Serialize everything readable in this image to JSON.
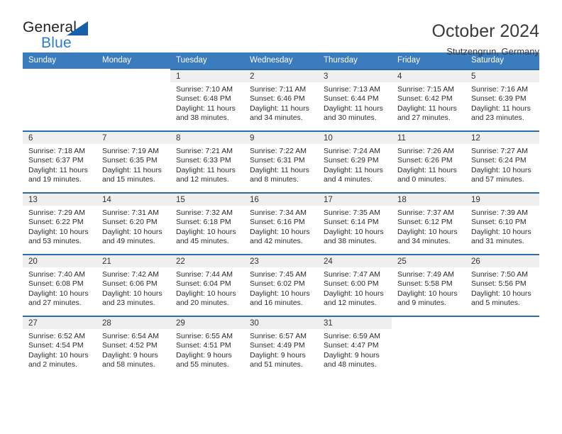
{
  "brand": {
    "name_part1": "General",
    "name_part2": "Blue",
    "triangle_color": "#1560a8",
    "blue_color": "#2b7cd3"
  },
  "header": {
    "title": "October 2024",
    "subtitle": "Stutzengrun, Germany"
  },
  "theme": {
    "header_bar_color": "#3a7cbe",
    "cell_rule_color": "#2d6da4",
    "daynum_band_color": "#efefef"
  },
  "weekday_headers": [
    "Sunday",
    "Monday",
    "Tuesday",
    "Wednesday",
    "Thursday",
    "Friday",
    "Saturday"
  ],
  "weeks": [
    [
      {
        "blank": true,
        "lead": true,
        "day": "",
        "sunrise": "",
        "sunset": "",
        "daylight": ""
      },
      {
        "blank": true,
        "lead": true,
        "day": "",
        "sunrise": "",
        "sunset": "",
        "daylight": ""
      },
      {
        "day": "1",
        "sunrise": "Sunrise: 7:10 AM",
        "sunset": "Sunset: 6:48 PM",
        "daylight": "Daylight: 11 hours and 38 minutes."
      },
      {
        "day": "2",
        "sunrise": "Sunrise: 7:11 AM",
        "sunset": "Sunset: 6:46 PM",
        "daylight": "Daylight: 11 hours and 34 minutes."
      },
      {
        "day": "3",
        "sunrise": "Sunrise: 7:13 AM",
        "sunset": "Sunset: 6:44 PM",
        "daylight": "Daylight: 11 hours and 30 minutes."
      },
      {
        "day": "4",
        "sunrise": "Sunrise: 7:15 AM",
        "sunset": "Sunset: 6:42 PM",
        "daylight": "Daylight: 11 hours and 27 minutes."
      },
      {
        "day": "5",
        "sunrise": "Sunrise: 7:16 AM",
        "sunset": "Sunset: 6:39 PM",
        "daylight": "Daylight: 11 hours and 23 minutes."
      }
    ],
    [
      {
        "day": "6",
        "sunrise": "Sunrise: 7:18 AM",
        "sunset": "Sunset: 6:37 PM",
        "daylight": "Daylight: 11 hours and 19 minutes."
      },
      {
        "day": "7",
        "sunrise": "Sunrise: 7:19 AM",
        "sunset": "Sunset: 6:35 PM",
        "daylight": "Daylight: 11 hours and 15 minutes."
      },
      {
        "day": "8",
        "sunrise": "Sunrise: 7:21 AM",
        "sunset": "Sunset: 6:33 PM",
        "daylight": "Daylight: 11 hours and 12 minutes."
      },
      {
        "day": "9",
        "sunrise": "Sunrise: 7:22 AM",
        "sunset": "Sunset: 6:31 PM",
        "daylight": "Daylight: 11 hours and 8 minutes."
      },
      {
        "day": "10",
        "sunrise": "Sunrise: 7:24 AM",
        "sunset": "Sunset: 6:29 PM",
        "daylight": "Daylight: 11 hours and 4 minutes."
      },
      {
        "day": "11",
        "sunrise": "Sunrise: 7:26 AM",
        "sunset": "Sunset: 6:26 PM",
        "daylight": "Daylight: 11 hours and 0 minutes."
      },
      {
        "day": "12",
        "sunrise": "Sunrise: 7:27 AM",
        "sunset": "Sunset: 6:24 PM",
        "daylight": "Daylight: 10 hours and 57 minutes."
      }
    ],
    [
      {
        "day": "13",
        "sunrise": "Sunrise: 7:29 AM",
        "sunset": "Sunset: 6:22 PM",
        "daylight": "Daylight: 10 hours and 53 minutes."
      },
      {
        "day": "14",
        "sunrise": "Sunrise: 7:31 AM",
        "sunset": "Sunset: 6:20 PM",
        "daylight": "Daylight: 10 hours and 49 minutes."
      },
      {
        "day": "15",
        "sunrise": "Sunrise: 7:32 AM",
        "sunset": "Sunset: 6:18 PM",
        "daylight": "Daylight: 10 hours and 45 minutes."
      },
      {
        "day": "16",
        "sunrise": "Sunrise: 7:34 AM",
        "sunset": "Sunset: 6:16 PM",
        "daylight": "Daylight: 10 hours and 42 minutes."
      },
      {
        "day": "17",
        "sunrise": "Sunrise: 7:35 AM",
        "sunset": "Sunset: 6:14 PM",
        "daylight": "Daylight: 10 hours and 38 minutes."
      },
      {
        "day": "18",
        "sunrise": "Sunrise: 7:37 AM",
        "sunset": "Sunset: 6:12 PM",
        "daylight": "Daylight: 10 hours and 34 minutes."
      },
      {
        "day": "19",
        "sunrise": "Sunrise: 7:39 AM",
        "sunset": "Sunset: 6:10 PM",
        "daylight": "Daylight: 10 hours and 31 minutes."
      }
    ],
    [
      {
        "day": "20",
        "sunrise": "Sunrise: 7:40 AM",
        "sunset": "Sunset: 6:08 PM",
        "daylight": "Daylight: 10 hours and 27 minutes."
      },
      {
        "day": "21",
        "sunrise": "Sunrise: 7:42 AM",
        "sunset": "Sunset: 6:06 PM",
        "daylight": "Daylight: 10 hours and 23 minutes."
      },
      {
        "day": "22",
        "sunrise": "Sunrise: 7:44 AM",
        "sunset": "Sunset: 6:04 PM",
        "daylight": "Daylight: 10 hours and 20 minutes."
      },
      {
        "day": "23",
        "sunrise": "Sunrise: 7:45 AM",
        "sunset": "Sunset: 6:02 PM",
        "daylight": "Daylight: 10 hours and 16 minutes."
      },
      {
        "day": "24",
        "sunrise": "Sunrise: 7:47 AM",
        "sunset": "Sunset: 6:00 PM",
        "daylight": "Daylight: 10 hours and 12 minutes."
      },
      {
        "day": "25",
        "sunrise": "Sunrise: 7:49 AM",
        "sunset": "Sunset: 5:58 PM",
        "daylight": "Daylight: 10 hours and 9 minutes."
      },
      {
        "day": "26",
        "sunrise": "Sunrise: 7:50 AM",
        "sunset": "Sunset: 5:56 PM",
        "daylight": "Daylight: 10 hours and 5 minutes."
      }
    ],
    [
      {
        "day": "27",
        "sunrise": "Sunrise: 6:52 AM",
        "sunset": "Sunset: 4:54 PM",
        "daylight": "Daylight: 10 hours and 2 minutes."
      },
      {
        "day": "28",
        "sunrise": "Sunrise: 6:54 AM",
        "sunset": "Sunset: 4:52 PM",
        "daylight": "Daylight: 9 hours and 58 minutes."
      },
      {
        "day": "29",
        "sunrise": "Sunrise: 6:55 AM",
        "sunset": "Sunset: 4:51 PM",
        "daylight": "Daylight: 9 hours and 55 minutes."
      },
      {
        "day": "30",
        "sunrise": "Sunrise: 6:57 AM",
        "sunset": "Sunset: 4:49 PM",
        "daylight": "Daylight: 9 hours and 51 minutes."
      },
      {
        "day": "31",
        "sunrise": "Sunrise: 6:59 AM",
        "sunset": "Sunset: 4:47 PM",
        "daylight": "Daylight: 9 hours and 48 minutes."
      },
      {
        "blank": true,
        "day": "",
        "sunrise": "",
        "sunset": "",
        "daylight": ""
      },
      {
        "blank": true,
        "day": "",
        "sunrise": "",
        "sunset": "",
        "daylight": ""
      }
    ]
  ]
}
